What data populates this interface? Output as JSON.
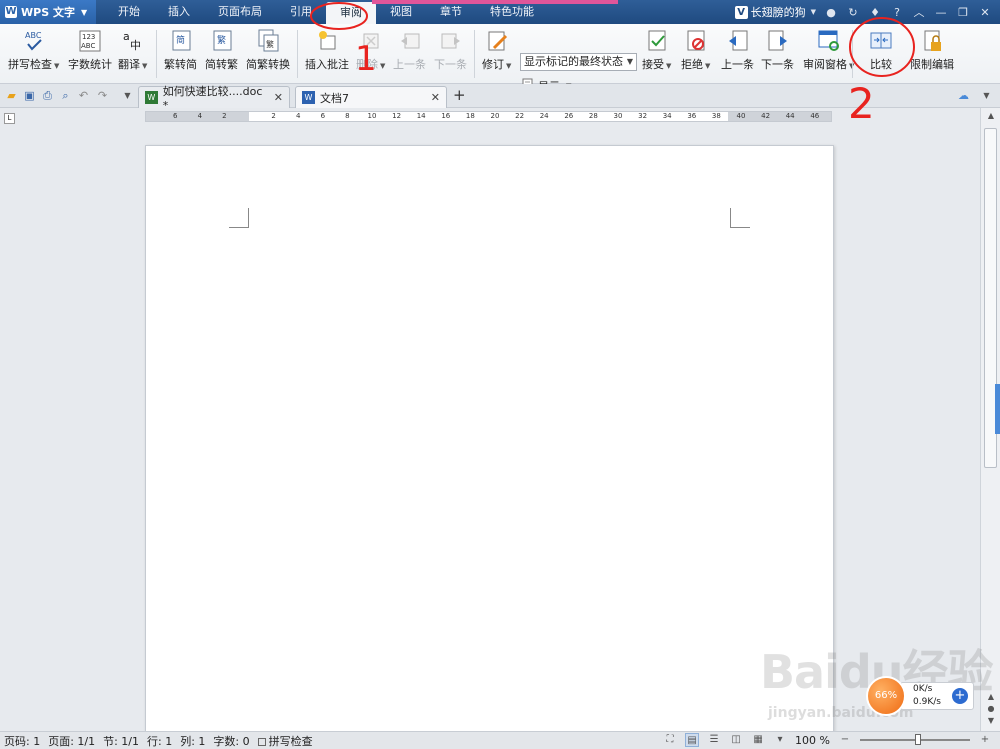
{
  "app": {
    "name": "WPS 文字"
  },
  "menu": {
    "items": [
      "开始",
      "插入",
      "页面布局",
      "引用",
      "审阅",
      "视图",
      "章节",
      "特色功能"
    ],
    "active_index": 4
  },
  "user": {
    "badge": "V",
    "name": "长翅膀的狗"
  },
  "window_controls": {
    "help": "?",
    "minimize": "—",
    "restore": "❐",
    "close": "✕"
  },
  "ribbon": {
    "spell_check": "拼写检查",
    "word_count": "字数统计",
    "translate": "翻译",
    "trad_to_simp": "繁转简",
    "simp_to_trad": "简转繁",
    "simp_trad_convert": "简繁转换",
    "insert_comment": "插入批注",
    "delete": "删除",
    "prev_comment": "上一条",
    "next_comment": "下一条",
    "track_changes": "修订",
    "markup_state": "显示标记的最终状态",
    "show": "显示",
    "accept": "接受",
    "reject": "拒绝",
    "prev_change": "上一条",
    "next_change": "下一条",
    "review_pane": "审阅窗格",
    "compare": "比较",
    "restrict_editing": "限制编辑"
  },
  "tabs": [
    {
      "title": "如何快速比较....doc *",
      "active": false
    },
    {
      "title": "文档7",
      "active": true
    }
  ],
  "ruler": {
    "labels_left": [
      "6",
      "4",
      "2"
    ],
    "labels_right": [
      "2",
      "4",
      "6",
      "8",
      "10",
      "12",
      "14",
      "16",
      "18",
      "20",
      "22",
      "24",
      "26",
      "28",
      "30",
      "32",
      "34",
      "36",
      "38",
      "40",
      "42",
      "44",
      "46"
    ]
  },
  "status": {
    "page_num": "页码: 1",
    "pages": "页面: 1/1",
    "section": "节: 1/1",
    "row": "行: 1",
    "col": "列: 1",
    "words": "字数: 0",
    "spell": "拼写检查",
    "zoom": "100 %"
  },
  "net_widget": {
    "percent": "66%",
    "up": "0K/s",
    "down": "0.9K/s"
  },
  "watermark": {
    "text": "Baidu经验",
    "url": "jingyan.baidu.com"
  },
  "annotations": {
    "label1": "1",
    "label2": "2",
    "color": "#e8231f"
  }
}
